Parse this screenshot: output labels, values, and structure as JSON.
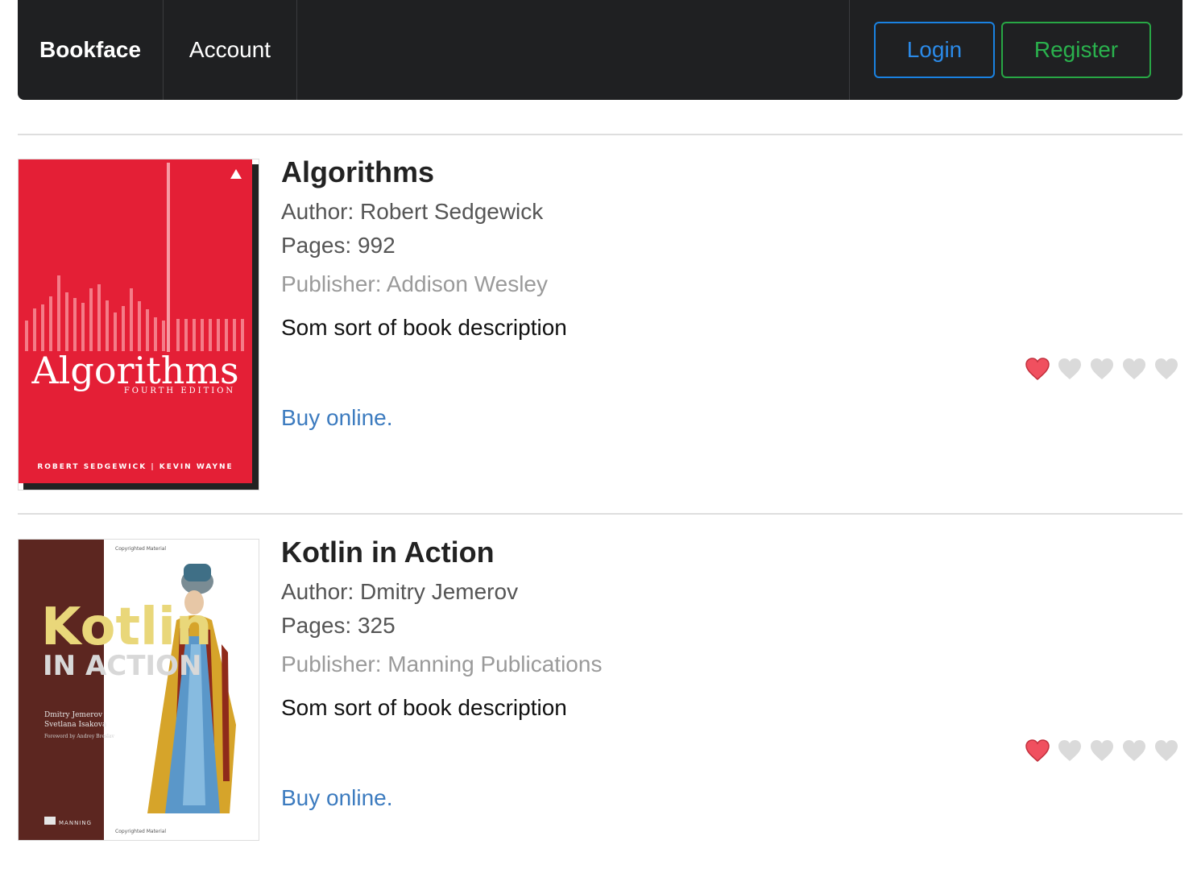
{
  "navbar": {
    "brand": "Bookface",
    "links": [
      "Account"
    ],
    "login_label": "Login",
    "register_label": "Register"
  },
  "books": [
    {
      "title": "Algorithms",
      "author": "Author: Robert Sedgewick",
      "pages": "Pages: 992",
      "publisher": "Publisher: Addison Wesley",
      "description": "Som sort of book description",
      "buy_label": "Buy online.",
      "rating": 1,
      "rating_max": 5,
      "cover": {
        "title": "Algorithms",
        "edition": "FOURTH EDITION",
        "authors": "ROBERT SEDGEWICK | KEVIN WAYNE",
        "color": "#e41f36"
      }
    },
    {
      "title": "Kotlin in Action",
      "author": "Author: Dmitry Jemerov",
      "pages": "Pages: 325",
      "publisher": "Publisher: Manning Publications",
      "description": "Som sort of book description",
      "buy_label": "Buy online.",
      "rating": 1,
      "rating_max": 5,
      "cover": {
        "top_note": "Copyrighted Material",
        "title_line1": "Kotlin",
        "title_line2": "IN ACTION",
        "author_line1": "Dmitry Jemerov",
        "author_line2": "Svetlana Isakova",
        "foreword": "Foreword by Andrey Breslav",
        "publisher": "MANNING",
        "bottom_note": "Copyrighted Material",
        "color": "#5c2620"
      }
    }
  ],
  "colors": {
    "heart_active": "#f0505f",
    "heart_inactive": "#dadada"
  }
}
